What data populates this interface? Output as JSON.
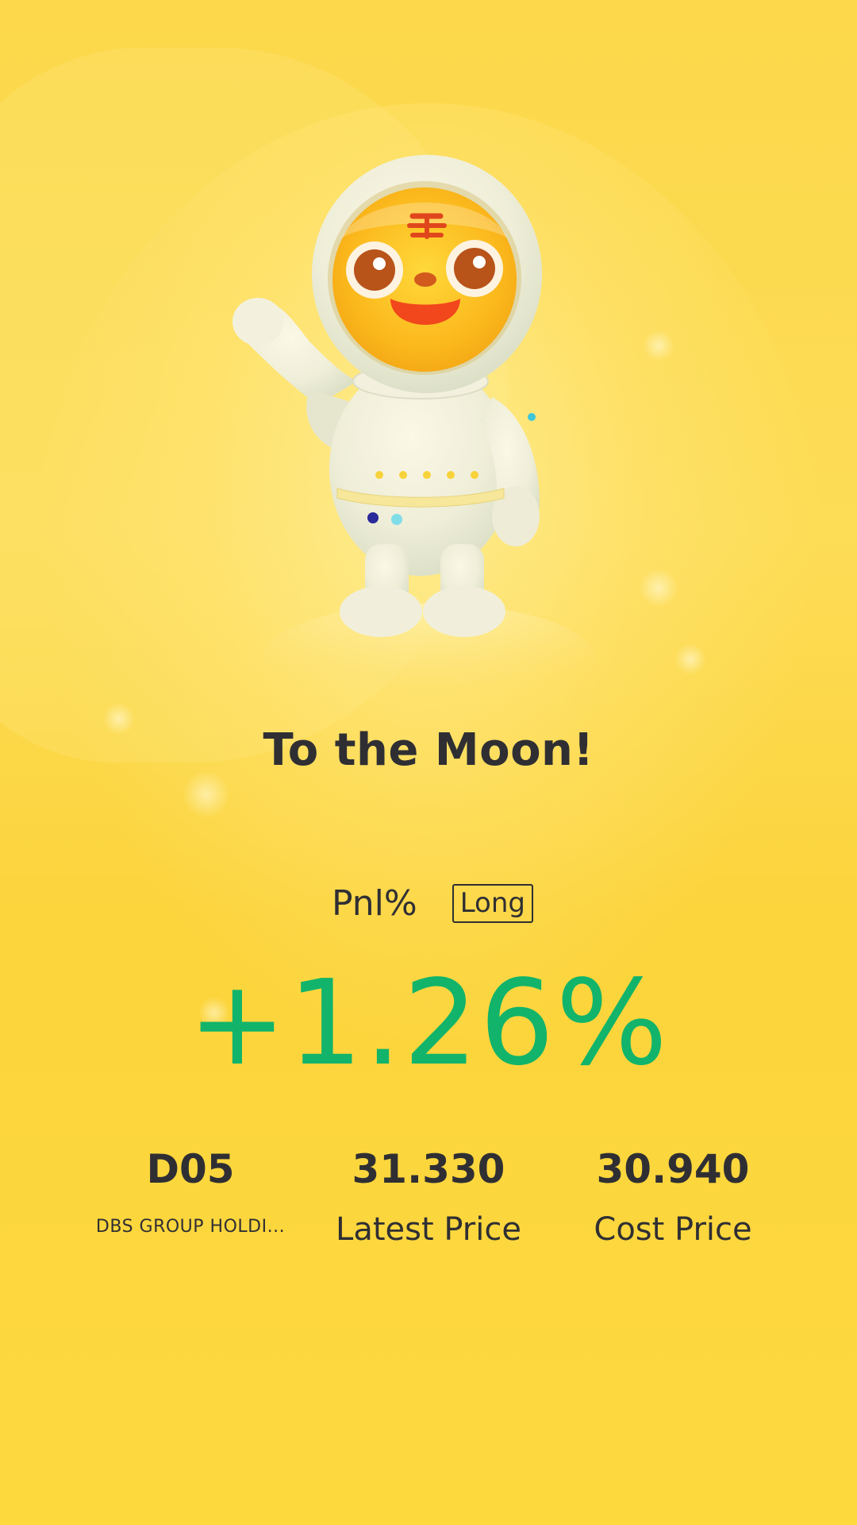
{
  "headline": "To the Moon!",
  "pnl": {
    "label": "Pnl%",
    "direction": "Long",
    "value": "+1.26%",
    "value_color": "#11b46a"
  },
  "stats": {
    "symbol": {
      "value": "D05",
      "label": "DBS GROUP HOLDI..."
    },
    "latest_price": {
      "value": "31.330",
      "label": "Latest Price"
    },
    "cost_price": {
      "value": "30.940",
      "label": "Cost Price"
    }
  },
  "theme": {
    "background": "#fcd84a",
    "text": "#2f2f33",
    "gain": "#11b46a"
  },
  "illustration": "tiger-astronaut-mascot"
}
